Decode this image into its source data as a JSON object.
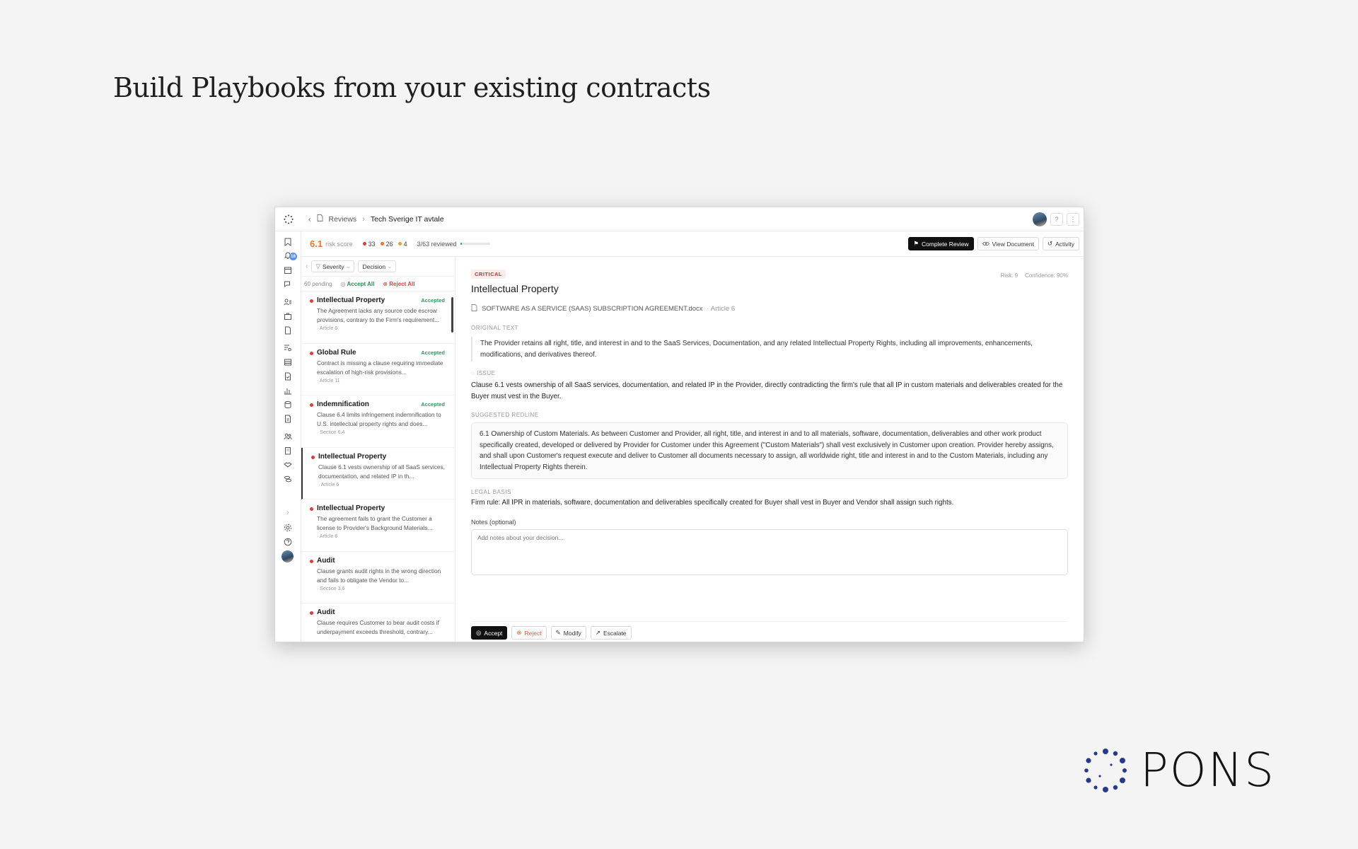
{
  "headline": "Build Playbooks from your existing contracts",
  "brand": {
    "wordmark": "PONS",
    "color": "#263a8c"
  },
  "app": {
    "breadcrumb": {
      "parent": "Reviews",
      "current": "Tech Sverige IT avtale"
    },
    "notification_count": "18",
    "stats": {
      "risk_score": "6.1",
      "risk_label": "risk score",
      "counts": [
        {
          "value": "33",
          "color": "#e03a3a"
        },
        {
          "value": "26",
          "color": "#e8762c"
        },
        {
          "value": "4",
          "color": "#e8a02c"
        }
      ],
      "reviewed": "3/63 reviewed",
      "reviewed_fraction": 0.048
    },
    "toolbar": {
      "complete": "Complete Review",
      "view_doc": "View Document",
      "activity": "Activity"
    },
    "filters": {
      "severity": "Severity",
      "decision": "Decision"
    },
    "pending": {
      "count": "60 pending",
      "accept_all": "Accept All",
      "reject_all": "Reject All"
    },
    "items": [
      {
        "title": "Intellectual Property",
        "status": "Accepted",
        "desc": "The Agreement lacks any source code escrow provisions, contrary to the Firm's requirement...",
        "ref": "· Article 6"
      },
      {
        "title": "Global Rule",
        "status": "Accepted",
        "desc": "Contract is missing a clause requiring immediate escalation of high-risk provisions...",
        "ref": "· Article 11"
      },
      {
        "title": "Indemnification",
        "status": "Accepted",
        "desc": "Clause 6.4 limits infringement indemnification to U.S. intellectual property rights and does...",
        "ref": "· Section 6.4"
      },
      {
        "title": "Intellectual Property",
        "status": "",
        "desc": "Clause 6.1 vests ownership of all SaaS services, documentation, and related IP in th...",
        "ref": "· Article 6"
      },
      {
        "title": "Intellectual Property",
        "status": "",
        "desc": "The agreement fails to grant the Customer a license to Provider's Background Materials...",
        "ref": "· Article 6"
      },
      {
        "title": "Audit",
        "status": "",
        "desc": "Clause grants audit rights in the wrong direction and fails to obligate the Vendor to...",
        "ref": "· Section 3.6"
      },
      {
        "title": "Audit",
        "status": "",
        "desc": "Clause requires Customer to bear audit costs if underpayment exceeds threshold, contrary...",
        "ref": ""
      }
    ],
    "detail": {
      "severity": "CRITICAL",
      "risk": "Risk: 9",
      "confidence": "Confidence: 90%",
      "title": "Intellectual Property",
      "document": "SOFTWARE AS A SERVICE (SAAS) SUBSCRIPTION AGREEMENT.docx",
      "doc_ref": "· Article 6",
      "original_label": "Original text",
      "original_text": "The Provider retains all right, title, and interest in and to the SaaS Services, Documentation, and any related Intellectual Property Rights, including all improvements, enhancements, modifications, and derivatives thereof.",
      "issue_label": "Issue",
      "issue_text": "Clause 6.1 vests ownership of all SaaS services, documentation, and related IP in the Provider, directly contradicting the firm's rule that all IP in custom materials and deliverables created for the Buyer must vest in the Buyer.",
      "redline_label": "Suggested redline",
      "redline_text": "6.1 Ownership of Custom Materials. As between Customer and Provider, all right, title, and interest in and to all materials, software, documentation, deliverables and other work product specifically created, developed or delivered by Provider for Customer under this Agreement (\"Custom Materials\") shall vest exclusively in Customer upon creation. Provider hereby assigns, and shall upon Customer's request execute and deliver to Customer all documents necessary to assign, all worldwide right, title and interest in and to the Custom Materials, including any Intellectual Property Rights therein.",
      "legal_label": "Legal basis",
      "legal_text": "Firm rule: All IPR in materials, software, documentation and deliverables specifically created for Buyer shall vest in Buyer and Vendor shall assign such rights.",
      "notes_label": "Notes (optional)",
      "notes_placeholder": "Add notes about your decision...",
      "actions": {
        "accept": "Accept",
        "reject": "Reject",
        "modify": "Modify",
        "escalate": "Escalate"
      }
    }
  }
}
